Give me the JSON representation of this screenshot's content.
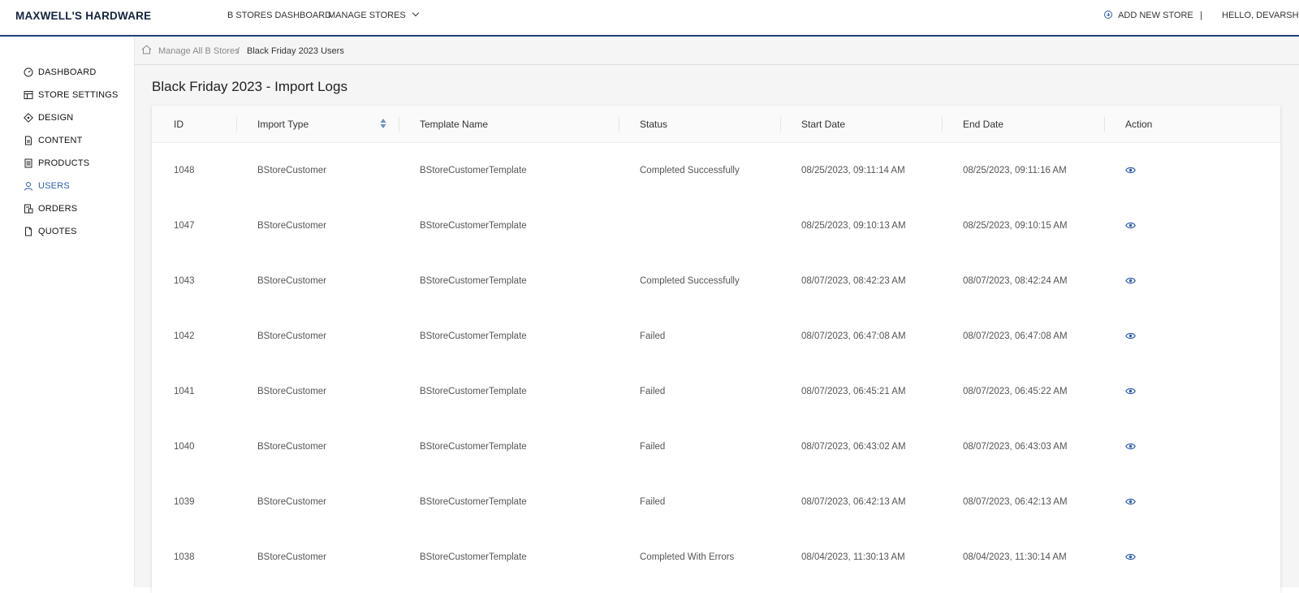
{
  "app": {
    "brand": "MAXWELL'S HARDWARE",
    "nav": {
      "dashboard": "B STORES DASHBOARD",
      "manage_stores": "MANAGE STORES"
    },
    "add_new_store": "ADD NEW STORE",
    "separator": "|",
    "greeting": "HELLO, DEVARSHI",
    "accent_color": "#2f5bb0",
    "header_border_color": "#1f3f7a"
  },
  "sidebar": {
    "items": [
      {
        "label": "DASHBOARD",
        "icon": "gauge-icon"
      },
      {
        "label": "STORE SETTINGS",
        "icon": "store-icon"
      },
      {
        "label": "DESIGN",
        "icon": "design-icon"
      },
      {
        "label": "CONTENT",
        "icon": "document-icon"
      },
      {
        "label": "PRODUCTS",
        "icon": "products-icon"
      },
      {
        "label": "USERS",
        "icon": "user-icon",
        "active": true
      },
      {
        "label": "ORDERS",
        "icon": "orders-icon"
      },
      {
        "label": "QUOTES",
        "icon": "quote-icon"
      }
    ]
  },
  "breadcrumb": {
    "items": [
      "Manage All B Stores",
      "Black Friday 2023 Users"
    ],
    "separator": "/"
  },
  "page": {
    "title": "Black Friday 2023 - Import Logs"
  },
  "table": {
    "columns": [
      "ID",
      "Import Type",
      "Template Name",
      "Status",
      "Start Date",
      "End Date",
      "Action"
    ],
    "rows": [
      [
        "1048",
        "BStoreCustomer",
        "BStoreCustomerTemplate",
        "Completed Successfully",
        "08/25/2023, 09:11:14 AM",
        "08/25/2023, 09:11:16 AM"
      ],
      [
        "1047",
        "BStoreCustomer",
        "BStoreCustomerTemplate",
        "",
        "08/25/2023, 09:10:13 AM",
        "08/25/2023, 09:10:15 AM"
      ],
      [
        "1043",
        "BStoreCustomer",
        "BStoreCustomerTemplate",
        "Completed Successfully",
        "08/07/2023, 08:42:23 AM",
        "08/07/2023, 08:42:24 AM"
      ],
      [
        "1042",
        "BStoreCustomer",
        "BStoreCustomerTemplate",
        "Failed",
        "08/07/2023, 06:47:08 AM",
        "08/07/2023, 06:47:08 AM"
      ],
      [
        "1041",
        "BStoreCustomer",
        "BStoreCustomerTemplate",
        "Failed",
        "08/07/2023, 06:45:21 AM",
        "08/07/2023, 06:45:22 AM"
      ],
      [
        "1040",
        "BStoreCustomer",
        "BStoreCustomerTemplate",
        "Failed",
        "08/07/2023, 06:43:02 AM",
        "08/07/2023, 06:43:03 AM"
      ],
      [
        "1039",
        "BStoreCustomer",
        "BStoreCustomerTemplate",
        "Failed",
        "08/07/2023, 06:42:13 AM",
        "08/07/2023, 06:42:13 AM"
      ],
      [
        "1038",
        "BStoreCustomer",
        "BStoreCustomerTemplate",
        "Completed With Errors",
        "08/04/2023, 11:30:13 AM",
        "08/04/2023, 11:30:14 AM"
      ]
    ],
    "action_icon": "eye-icon"
  }
}
